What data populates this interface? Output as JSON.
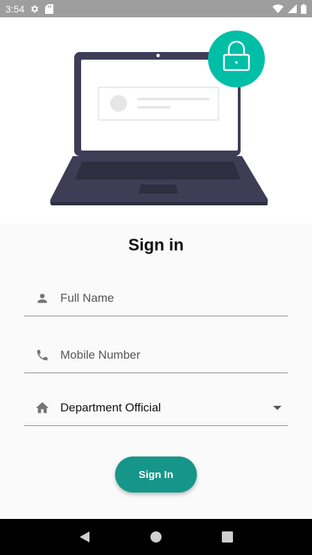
{
  "status_bar": {
    "time": "3:54",
    "icons": [
      "settings-icon",
      "sd-card-icon",
      "wifi-icon",
      "signal-icon",
      "battery-icon"
    ]
  },
  "hero": {
    "illustration": "laptop-with-lock",
    "colors": {
      "laptop": "#3f3d56",
      "lock_badge": "#00bfa6",
      "screen": "#ffffff"
    }
  },
  "form": {
    "title": "Sign in",
    "full_name_placeholder": "Full Name",
    "mobile_placeholder": "Mobile Number",
    "department_value": "Department Official",
    "submit_label": "Sign In"
  },
  "colors": {
    "accent": "#16968a",
    "icon_gray": "#757575"
  },
  "nav_bar": {
    "buttons": [
      "back-icon",
      "home-icon",
      "recents-icon"
    ]
  }
}
